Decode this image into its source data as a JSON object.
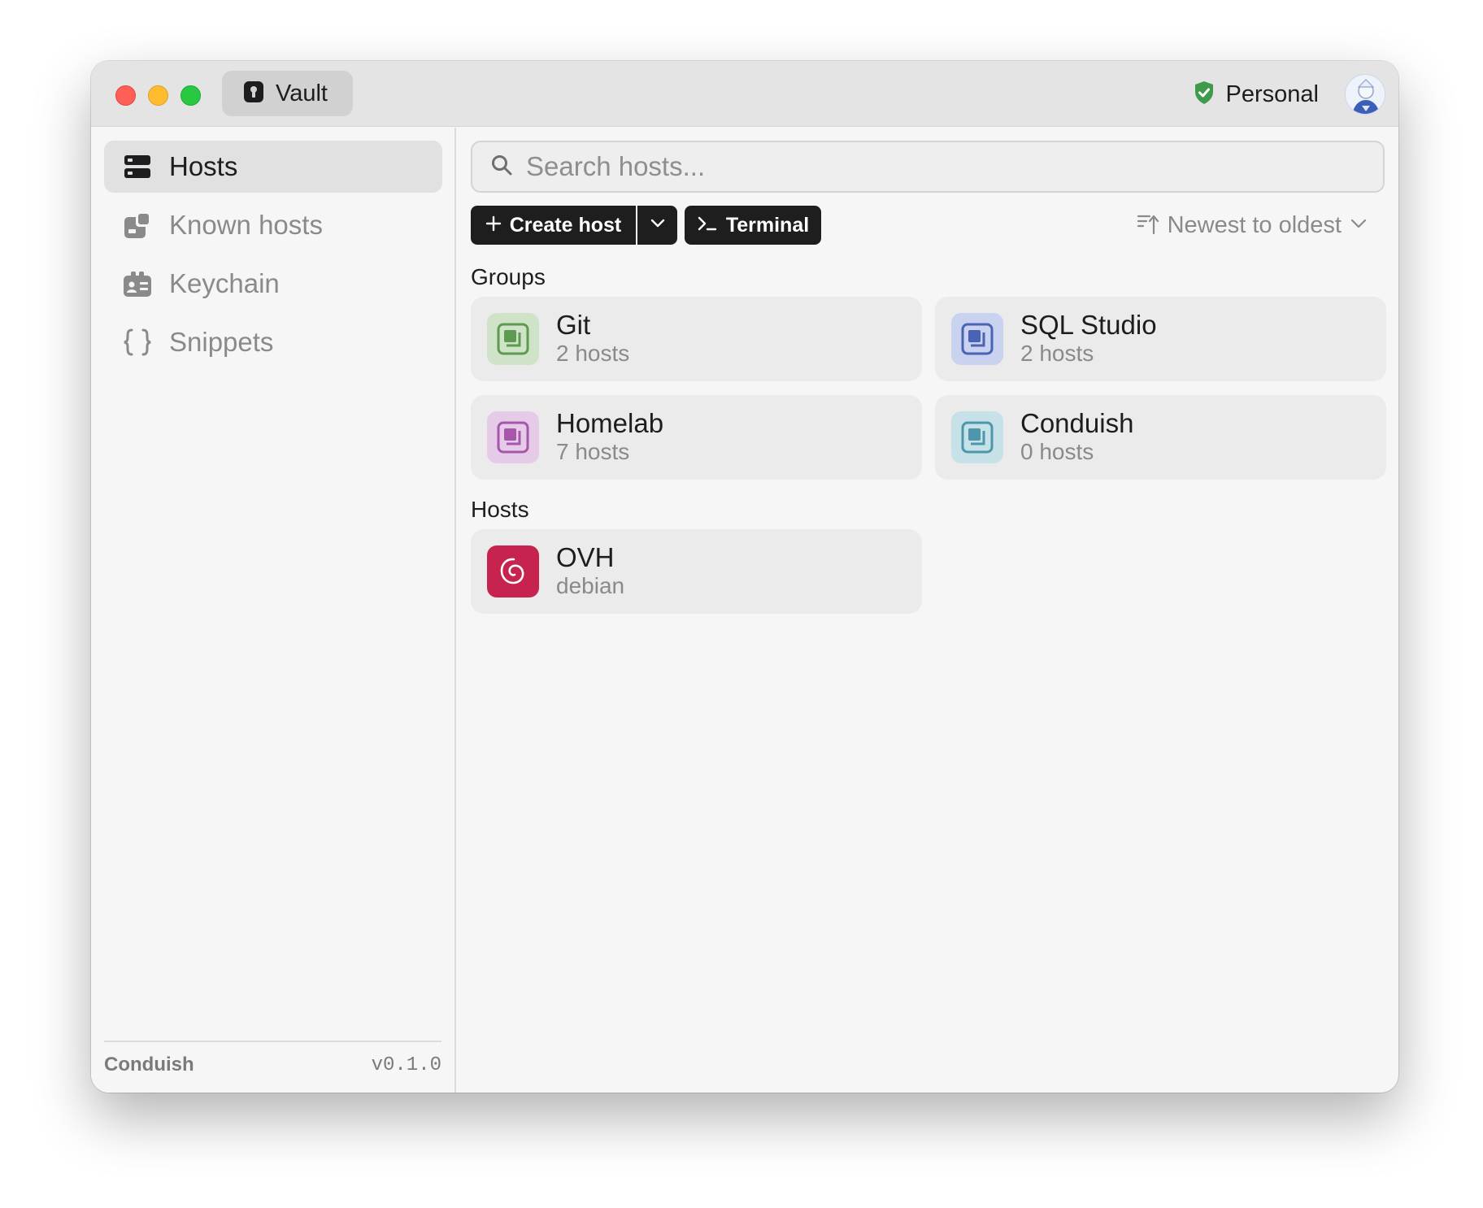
{
  "window": {
    "tab_label": "Vault",
    "workspace_label": "Personal"
  },
  "sidebar": {
    "items": [
      {
        "label": "Hosts",
        "icon": "server-stack-icon",
        "active": true
      },
      {
        "label": "Known hosts",
        "icon": "known-hosts-icon",
        "active": false
      },
      {
        "label": "Keychain",
        "icon": "keychain-icon",
        "active": false
      },
      {
        "label": "Snippets",
        "icon": "braces-icon",
        "active": false
      }
    ],
    "footer": {
      "app_name": "Conduish",
      "version": "v0.1.0"
    }
  },
  "main": {
    "search": {
      "placeholder": "Search hosts...",
      "value": ""
    },
    "toolbar": {
      "create_label": "Create host",
      "terminal_label": "Terminal",
      "sort_label": "Newest to oldest"
    },
    "groups_title": "Groups",
    "groups": [
      {
        "name": "Git",
        "count": "2 hosts",
        "color": "#5e9a52",
        "bg": "#cfe3c8"
      },
      {
        "name": "SQL Studio",
        "count": "2 hosts",
        "color": "#4a63b5",
        "bg": "#c9d2ef"
      },
      {
        "name": "Homelab",
        "count": "7 hosts",
        "color": "#a657ac",
        "bg": "#e6cbe8"
      },
      {
        "name": "Conduish",
        "count": "0 hosts",
        "color": "#4e96ab",
        "bg": "#c7e1e8"
      }
    ],
    "hosts_title": "Hosts",
    "hosts": [
      {
        "name": "OVH",
        "os": "debian",
        "color": "#c7234f"
      }
    ]
  },
  "colors": {
    "traffic_red": "#fe5f57",
    "traffic_yellow": "#febc2e",
    "traffic_green": "#28c840",
    "workspace_shield": "#3f9a4c",
    "dark_button": "#1e1e1e"
  }
}
